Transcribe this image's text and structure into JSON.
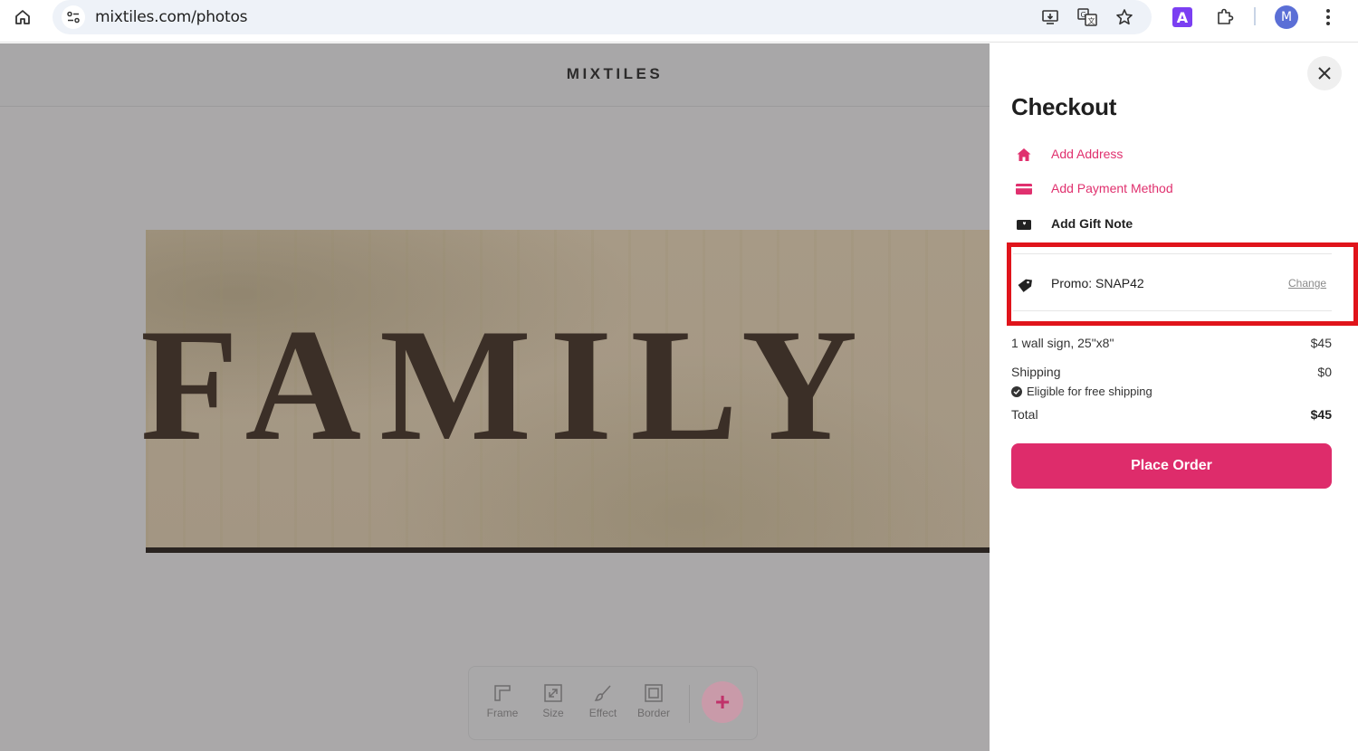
{
  "browser": {
    "url": "mixtiles.com/photos",
    "profile_initial": "M",
    "extension_letter": "A",
    "icons": [
      "home-icon",
      "site-info-icon",
      "install-app-icon",
      "translate-icon",
      "bookmark-star-icon",
      "extension-a-icon",
      "extensions-puzzle-icon",
      "profile-avatar",
      "more-menu-icon"
    ]
  },
  "page": {
    "logo": "MIXTILES",
    "sign_text": "FAMILY",
    "toolbar": {
      "items": [
        {
          "label": "Frame",
          "icon": "frame-icon"
        },
        {
          "label": "Size",
          "icon": "resize-icon"
        },
        {
          "label": "Effect",
          "icon": "brush-icon"
        },
        {
          "label": "Border",
          "icon": "border-icon"
        }
      ],
      "add_label": "+"
    }
  },
  "checkout": {
    "title": "Checkout",
    "actions": [
      {
        "label": "Add Address",
        "icon": "home-icon"
      },
      {
        "label": "Add Payment Method",
        "icon": "credit-card-icon"
      },
      {
        "label": "Add Gift Note",
        "icon": "gift-note-icon"
      }
    ],
    "promo": {
      "label": "Promo: SNAP42",
      "change_label": "Change",
      "icon": "tag-icon"
    },
    "summary": {
      "item_label": "1 wall sign, 25\"x8\"",
      "item_price": "$45",
      "shipping_label": "Shipping",
      "shipping_price": "$0",
      "free_shipping_note": "Eligible for free shipping",
      "total_label": "Total",
      "total_price": "$45"
    },
    "place_order_label": "Place Order"
  },
  "colors": {
    "accent": "#de2c6b",
    "highlight_box": "#e0141b",
    "overlay": "#aaa8a9"
  }
}
